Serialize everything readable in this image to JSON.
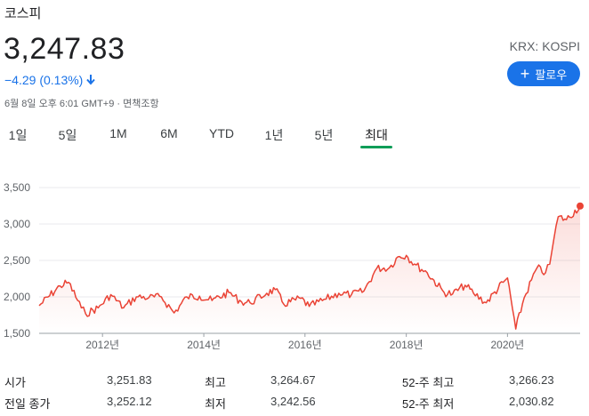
{
  "header": {
    "title": "코스피",
    "price": "3,247.83",
    "change": "−4.29 (0.13%)",
    "timestamp": "6월 8일 오후 6:01 GMT+9 · 면책조항",
    "exchange": "KRX: KOSPI",
    "follow_label": "팔로우",
    "change_direction": "down",
    "accent_color": "#1a73e8"
  },
  "tabs": [
    {
      "label": "1일"
    },
    {
      "label": "5일"
    },
    {
      "label": "1M"
    },
    {
      "label": "6M"
    },
    {
      "label": "YTD"
    },
    {
      "label": "1년"
    },
    {
      "label": "5년"
    },
    {
      "label": "최대",
      "active": true
    }
  ],
  "chart_data": {
    "type": "area",
    "ylim": [
      1500,
      3500
    ],
    "y_ticks": [
      "3,500",
      "3,000",
      "2,500",
      "2,000",
      "1,500"
    ],
    "x_ticks": [
      "2012년",
      "2014년",
      "2016년",
      "2018년",
      "2020년"
    ],
    "line_color": "#ea4335",
    "x": [
      "2010-10",
      "2011-03",
      "2011-05",
      "2011-08",
      "2011-09",
      "2011-12",
      "2012-03",
      "2012-06",
      "2012-09",
      "2012-12",
      "2013-03",
      "2013-06",
      "2013-09",
      "2013-12",
      "2014-03",
      "2014-07",
      "2014-10",
      "2014-12",
      "2015-04",
      "2015-06",
      "2015-08",
      "2015-12",
      "2016-02",
      "2016-06",
      "2016-09",
      "2016-12",
      "2017-03",
      "2017-06",
      "2017-09",
      "2017-11",
      "2018-01",
      "2018-03",
      "2018-06",
      "2018-10",
      "2018-12",
      "2019-03",
      "2019-05",
      "2019-08",
      "2019-12",
      "2020-01",
      "2020-03",
      "2020-05",
      "2020-08",
      "2020-10",
      "2020-11",
      "2020-12",
      "2021-01",
      "2021-03",
      "2021-06-08"
    ],
    "values": [
      1880,
      2150,
      2200,
      1850,
      1770,
      1850,
      2030,
      1850,
      2000,
      1990,
      2000,
      1780,
      2000,
      2010,
      1950,
      2060,
      1930,
      1920,
      2050,
      2100,
      1900,
      1980,
      1870,
      1970,
      2050,
      2030,
      2080,
      2390,
      2400,
      2550,
      2570,
      2450,
      2330,
      2060,
      2040,
      2160,
      2050,
      1920,
      2200,
      2260,
      1560,
      1990,
      2400,
      2330,
      2450,
      2800,
      3100,
      3060,
      3247
    ]
  },
  "stats": {
    "open_label": "시가",
    "open": "3,251.83",
    "high_label": "최고",
    "high": "3,264.67",
    "wk52_high_label": "52-주 최고",
    "wk52_high": "3,266.23",
    "prev_close_label": "전일 종가",
    "prev_close": "3,252.12",
    "low_label": "최저",
    "low": "3,242.56",
    "wk52_low_label": "52-주 최저",
    "wk52_low": "2,030.82"
  }
}
